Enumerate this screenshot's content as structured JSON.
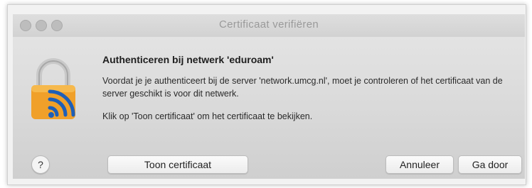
{
  "dialog": {
    "title": "Certificaat verifiëren",
    "heading": "Authenticeren bij netwerk 'eduroam'",
    "body": "Voordat je je authenticeert bij de server 'network.umcg.nl', moet je controleren of het certificaat van de server geschikt is voor dit netwerk.",
    "hint": "Klik op 'Toon certificaat' om het certificaat te bekijken.",
    "icon": "lock-wifi-icon"
  },
  "buttons": {
    "help": "?",
    "show_certificate": "Toon certificaat",
    "cancel": "Annuleer",
    "continue": "Ga door"
  },
  "colors": {
    "lock_body": "#f0a02a",
    "lock_shackle": "#c9c9c9",
    "wifi": "#1e5fb8"
  }
}
